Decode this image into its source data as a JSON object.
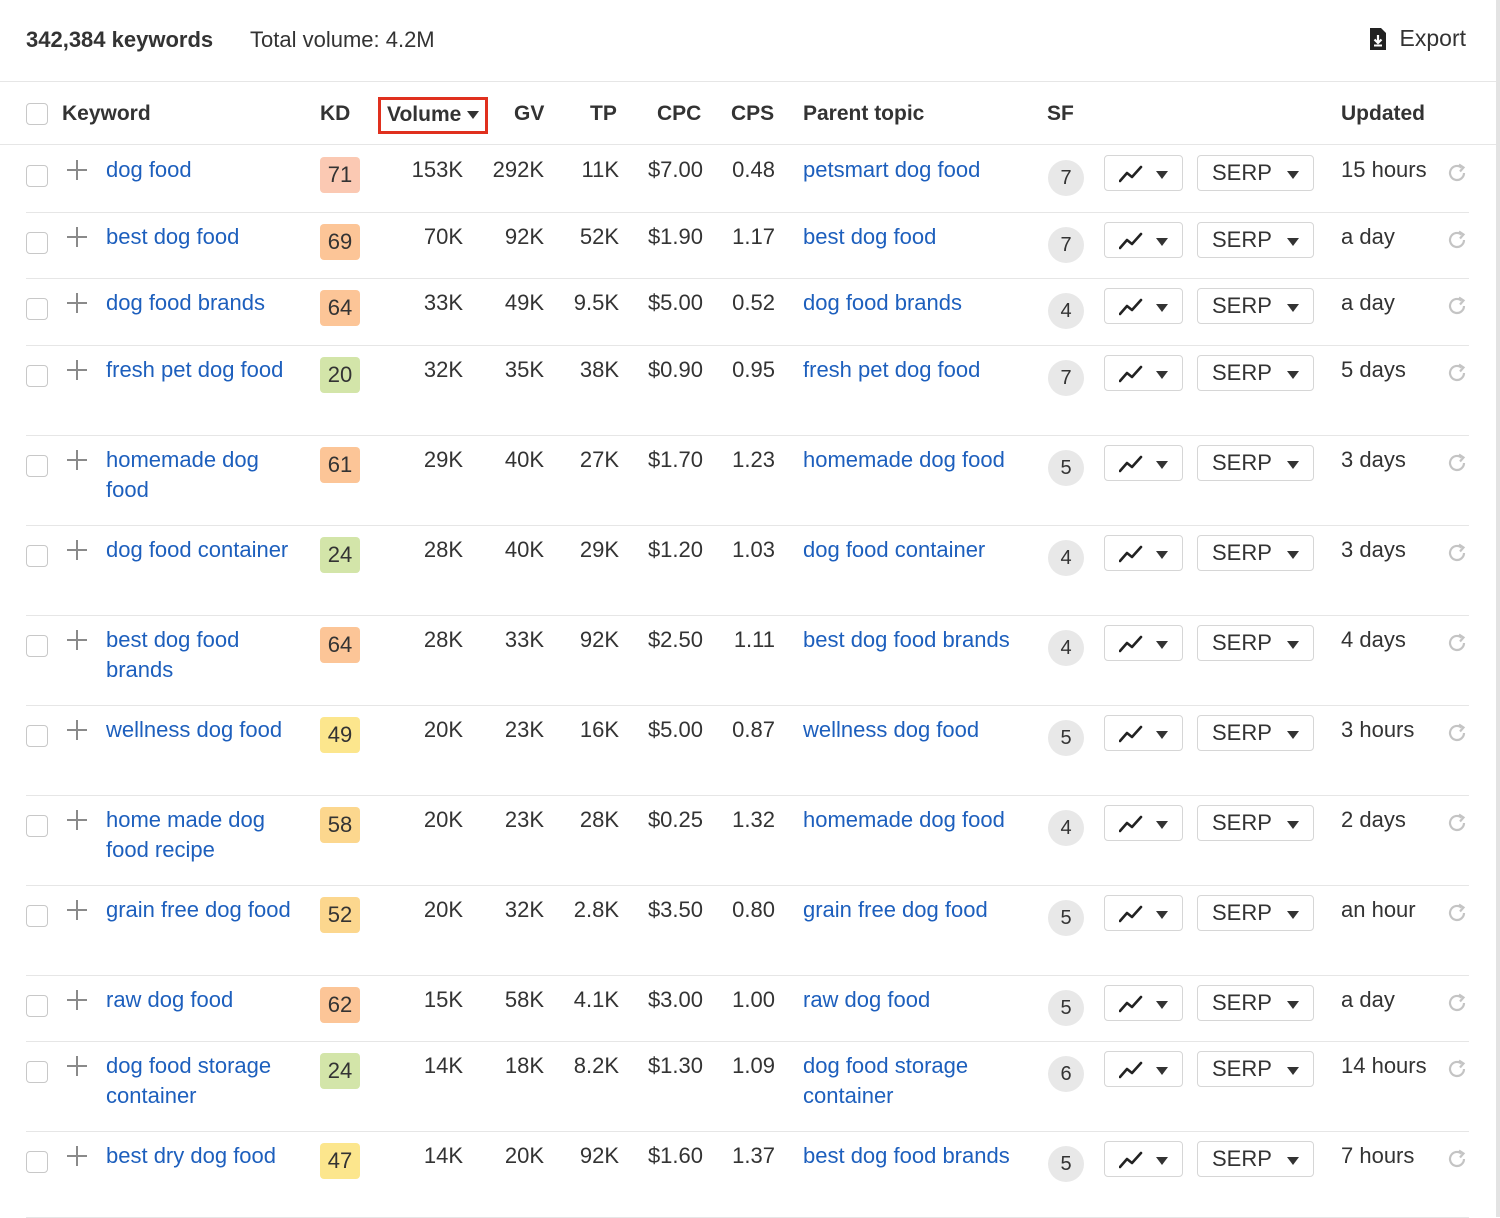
{
  "summary": {
    "keyword_count": "342,384 keywords",
    "total_volume": "Total volume: 4.2M",
    "export_label": "Export"
  },
  "columns": {
    "keyword": "Keyword",
    "kd": "KD",
    "volume": "Volume",
    "gv": "GV",
    "tp": "TP",
    "cpc": "CPC",
    "cps": "CPS",
    "parent_topic": "Parent topic",
    "sf": "SF",
    "updated": "Updated"
  },
  "sorted_column": "volume",
  "sort_direction": "descending",
  "serp_label": "SERP",
  "kd_colors": {
    "red": "#fbc9b3",
    "orange": "#fcc597",
    "amber": "#fcd78e",
    "yellow": "#fce68d",
    "green": "#d3e5a9"
  },
  "rows": [
    {
      "keyword": "dog food",
      "kd": "71",
      "kd_color": "#fbc9b3",
      "volume": "153K",
      "gv": "292K",
      "tp": "11K",
      "cpc": "$7.00",
      "cps": "0.48",
      "parent_topic": "petsmart dog food",
      "sf": "7",
      "updated": "15 hours"
    },
    {
      "keyword": "best dog food",
      "kd": "69",
      "kd_color": "#fcc597",
      "volume": "70K",
      "gv": "92K",
      "tp": "52K",
      "cpc": "$1.90",
      "cps": "1.17",
      "parent_topic": "best dog food",
      "sf": "7",
      "updated": "a day"
    },
    {
      "keyword": "dog food brands",
      "kd": "64",
      "kd_color": "#fcc597",
      "volume": "33K",
      "gv": "49K",
      "tp": "9.5K",
      "cpc": "$5.00",
      "cps": "0.52",
      "parent_topic": "dog food brands",
      "sf": "4",
      "updated": "a day"
    },
    {
      "keyword": "fresh pet dog food",
      "kd": "20",
      "kd_color": "#d3e5a9",
      "volume": "32K",
      "gv": "35K",
      "tp": "38K",
      "cpc": "$0.90",
      "cps": "0.95",
      "parent_topic": "fresh pet dog food",
      "sf": "7",
      "updated": "5 days"
    },
    {
      "keyword": "homemade dog food",
      "kd": "61",
      "kd_color": "#fcc597",
      "volume": "29K",
      "gv": "40K",
      "tp": "27K",
      "cpc": "$1.70",
      "cps": "1.23",
      "parent_topic": "homemade dog food",
      "sf": "5",
      "updated": "3 days"
    },
    {
      "keyword": "dog food container",
      "kd": "24",
      "kd_color": "#d3e5a9",
      "volume": "28K",
      "gv": "40K",
      "tp": "29K",
      "cpc": "$1.20",
      "cps": "1.03",
      "parent_topic": "dog food container",
      "sf": "4",
      "updated": "3 days"
    },
    {
      "keyword": "best dog food brands",
      "kd": "64",
      "kd_color": "#fcc597",
      "volume": "28K",
      "gv": "33K",
      "tp": "92K",
      "cpc": "$2.50",
      "cps": "1.11",
      "parent_topic": "best dog food brands",
      "sf": "4",
      "updated": "4 days"
    },
    {
      "keyword": "wellness dog food",
      "kd": "49",
      "kd_color": "#fce68d",
      "volume": "20K",
      "gv": "23K",
      "tp": "16K",
      "cpc": "$5.00",
      "cps": "0.87",
      "parent_topic": "wellness dog food",
      "sf": "5",
      "updated": "3 hours"
    },
    {
      "keyword": "home made dog food recipe",
      "kd": "58",
      "kd_color": "#fcd78e",
      "volume": "20K",
      "gv": "23K",
      "tp": "28K",
      "cpc": "$0.25",
      "cps": "1.32",
      "parent_topic": "homemade dog food",
      "sf": "4",
      "updated": "2 days"
    },
    {
      "keyword": "grain free dog food",
      "kd": "52",
      "kd_color": "#fcd78e",
      "volume": "20K",
      "gv": "32K",
      "tp": "2.8K",
      "cpc": "$3.50",
      "cps": "0.80",
      "parent_topic": "grain free dog food",
      "sf": "5",
      "updated": "an hour"
    },
    {
      "keyword": "raw dog food",
      "kd": "62",
      "kd_color": "#fcc597",
      "volume": "15K",
      "gv": "58K",
      "tp": "4.1K",
      "cpc": "$3.00",
      "cps": "1.00",
      "parent_topic": "raw dog food",
      "sf": "5",
      "updated": "a day"
    },
    {
      "keyword": "dog food storage container",
      "kd": "24",
      "kd_color": "#d3e5a9",
      "volume": "14K",
      "gv": "18K",
      "tp": "8.2K",
      "cpc": "$1.30",
      "cps": "1.09",
      "parent_topic": "dog food storage container",
      "sf": "6",
      "updated": "14 hours"
    },
    {
      "keyword": "best dry dog food",
      "kd": "47",
      "kd_color": "#fce68d",
      "volume": "14K",
      "gv": "20K",
      "tp": "92K",
      "cpc": "$1.60",
      "cps": "1.37",
      "parent_topic": "best dog food brands",
      "sf": "5",
      "updated": "7 hours"
    }
  ]
}
